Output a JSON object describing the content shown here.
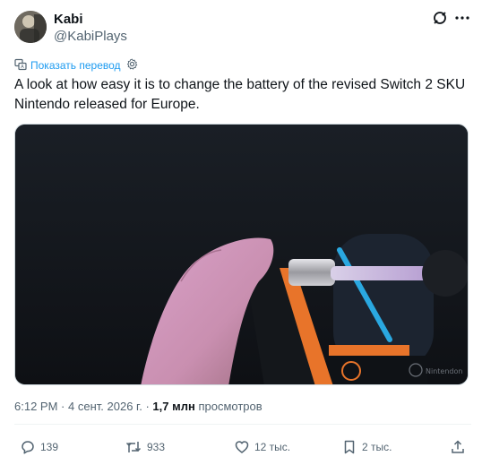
{
  "author": {
    "display_name": "Kabi",
    "handle": "@KabiPlays"
  },
  "icons": {
    "grok": "grok-icon",
    "more": "more-icon",
    "translate": "translate-icon",
    "settings": "gear-icon",
    "reply": "reply-icon",
    "repost": "repost-icon",
    "like": "heart-icon",
    "bookmark": "bookmark-icon",
    "share": "share-icon"
  },
  "translate": {
    "label": "Показать перевод"
  },
  "tweet": {
    "text": "A look at how easy it is to change the battery of the revised Switch 2 SKU Nintendo released for Europe."
  },
  "media": {
    "watermark": "Nintendon"
  },
  "meta": {
    "time": "6:12 PM",
    "dot1": "·",
    "date": "4 сент. 2026 г.",
    "dot2": "·",
    "views_count": "1,7 млн",
    "views_label": "просмотров"
  },
  "actions": {
    "replies": "139",
    "reposts": "933",
    "likes": "12 тыс.",
    "bookmarks": "2 тыс."
  },
  "colors": {
    "accent": "#1d9bf0",
    "text": "#0f1419",
    "secondary": "#536471"
  }
}
